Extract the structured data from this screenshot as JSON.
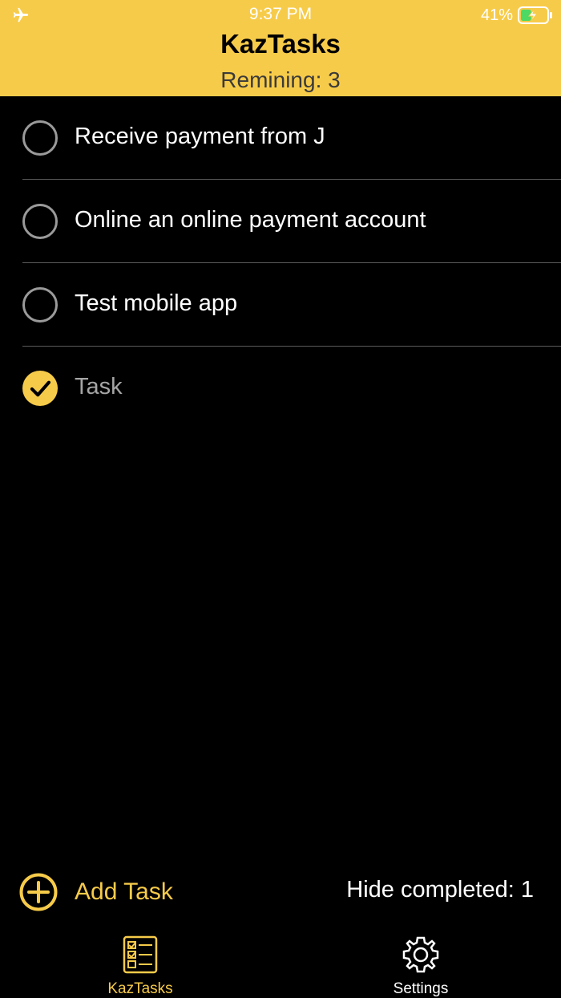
{
  "status_bar": {
    "time": "9:37 PM",
    "battery_percent": "41%",
    "battery_level": 0.41,
    "airplane_icon": "airplane-icon",
    "battery_icon": "battery-charging-icon"
  },
  "header": {
    "title": "KazTasks",
    "remaining": "Remining: 3"
  },
  "tasks": [
    {
      "label": "Receive payment from J",
      "completed": false
    },
    {
      "label": "Online an online payment account",
      "completed": false
    },
    {
      "label": "Test mobile app",
      "completed": false
    },
    {
      "label": "Task",
      "completed": true
    }
  ],
  "actions": {
    "add_task_label": "Add Task",
    "add_icon": "plus-circle-icon",
    "hide_completed_label": "Hide completed: 1"
  },
  "tab_bar": {
    "tabs": [
      {
        "label": "KazTasks",
        "icon": "checklist-icon",
        "selected": true
      },
      {
        "label": "Settings",
        "icon": "gear-icon",
        "selected": false
      }
    ]
  },
  "colors": {
    "accent": "#F7CB4A",
    "background": "#000000",
    "text": "#FFFFFF",
    "completed_text": "#A5A5A5",
    "separator": "#5A5A5A",
    "unchecked_ring": "#9A9A9A"
  }
}
